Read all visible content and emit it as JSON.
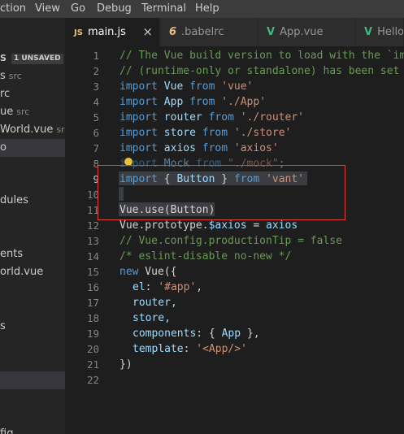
{
  "menu": {
    "selection": "ction",
    "view": "View",
    "go": "Go",
    "debug": "Debug",
    "terminal": "Terminal",
    "help": "Help"
  },
  "sidebar": {
    "open_editors": "S",
    "unsaved_badge": "1 UNSAVED",
    "row1_name": "s",
    "row1_dir": "src",
    "row2_name": "rc",
    "row3_name": "ue",
    "row3_dir": "src",
    "row4_name": "World.vue",
    "row4_dir": "sr...",
    "row5_name": "o",
    "row6_name": "dules",
    "row7_name": "ents",
    "row8_name": "orld.vue",
    "row9_name": "s",
    "row10_name": "fig"
  },
  "tabs": [
    {
      "icon": "JS",
      "label": "main.js",
      "close": "×",
      "active": true
    },
    {
      "icon": "6",
      "label": ".babelrc"
    },
    {
      "icon": "V",
      "label": "App.vue"
    },
    {
      "icon": "V",
      "label": "Hello"
    }
  ],
  "line_numbers": [
    "1",
    "2",
    "3",
    "4",
    "5",
    "6",
    "7",
    "8",
    "9",
    "10",
    "11",
    "12",
    "13",
    "14",
    "15",
    "16",
    "17",
    "18",
    "19",
    "20",
    "21",
    "22"
  ],
  "code": {
    "l1": "// The Vue build version to load with the `import` command",
    "l2": "// (runtime-only or standalone) has been set in webpack.base.conf",
    "l3": {
      "kw": "import",
      "id": "Vue",
      "from": "from",
      "str": "'vue'"
    },
    "l4": {
      "kw": "import",
      "id": "App",
      "from": "from",
      "str": "'./App'"
    },
    "l5": {
      "kw": "import",
      "id": "router",
      "from": "from",
      "str": "'./router'"
    },
    "l6": {
      "kw": "import",
      "id": "store",
      "from": "from",
      "str": "'./store'"
    },
    "l7": {
      "kw": "import",
      "id": "axios",
      "from": "from",
      "str": "'axios'"
    },
    "l8": {
      "kw": "import",
      "id": "Mock",
      "from": "from",
      "str": "\"./mock\"",
      "tail": ";"
    },
    "l9": {
      "kw": "import",
      "brace_open": "{",
      "id": "Button",
      "brace_close": "}",
      "from": "from",
      "str": "'vant'"
    },
    "l11": "Vue.use(Button)",
    "l12": {
      "a": "Vue.prototype.",
      "b": "$axios",
      "c": " = ",
      "d": "axios"
    },
    "l13": "// Vue.config.productionTip = false",
    "l14": "/* eslint-disable no-new */",
    "l15": {
      "kw": "new",
      "rest": " Vue({"
    },
    "l16": {
      "key": "el",
      "colon": ": ",
      "str": "'#app'",
      "tail": ","
    },
    "l17": "router,",
    "l18": "store,",
    "l19": {
      "key": "components",
      "rest": ": { ",
      "id": "App",
      "tail": " },"
    },
    "l20": {
      "key": "template",
      "colon": ": ",
      "str": "'<App/>'"
    },
    "l21": "})"
  },
  "colors": {
    "keyword": "#569cd6",
    "string": "#ce9178",
    "comment": "#6a9955",
    "variable": "#9cdcfe",
    "annotation": "#e04040"
  }
}
